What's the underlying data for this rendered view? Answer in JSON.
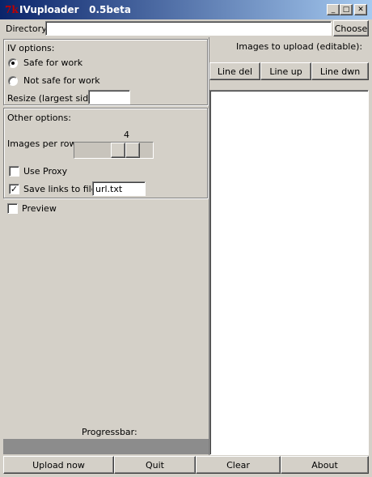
{
  "window": {
    "app_icon": "7k",
    "title": "IVuploader   0.5beta",
    "minimize_glyph": "_",
    "maximize_glyph": "□",
    "close_glyph": "✕"
  },
  "directory": {
    "label": "Directory:",
    "value": "",
    "choose_label": "Choose"
  },
  "iv_options": {
    "heading": "IV options:",
    "safe_label": "Safe for work",
    "safe_selected": true,
    "notsafe_label": "Not safe for work",
    "resize_label": "Resize (largest side):",
    "resize_value": ""
  },
  "other_options": {
    "heading": "Other options:",
    "images_per_row_label": "Images per row:",
    "images_per_row_value": "4",
    "use_proxy_label": "Use Proxy",
    "use_proxy_checked": false,
    "save_links_label": "Save links to file:",
    "save_links_checked": true,
    "save_links_value": "url.txt",
    "check_glyph": "✓"
  },
  "preview": {
    "label": "Preview",
    "checked": false
  },
  "progress": {
    "label": "Progressbar:"
  },
  "images_panel": {
    "heading": "Images to upload (editable):",
    "line_del": "Line del",
    "line_up": "Line up",
    "line_dwn": "Line dwn",
    "content": ""
  },
  "footer": {
    "upload_label": "Upload now",
    "quit_label": "Quit",
    "clear_label": "Clear",
    "about_label": "About"
  }
}
